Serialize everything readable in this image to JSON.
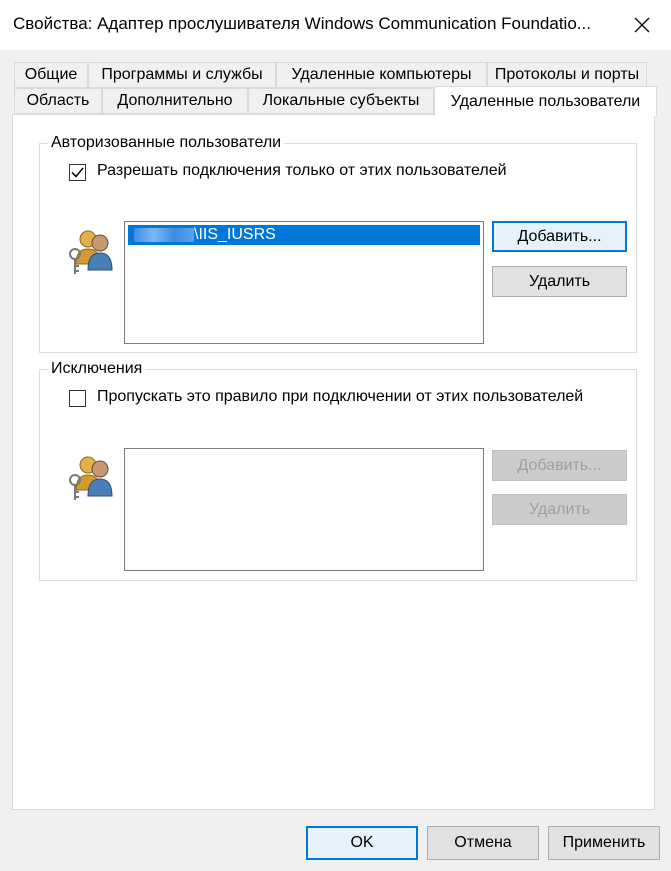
{
  "window": {
    "title": "Свойства: Адаптер прослушивателя Windows Communication Foundatio...",
    "close_icon": "close-icon"
  },
  "tabs_row1": [
    "Общие",
    "Программы и службы",
    "Удаленные компьютеры",
    "Протоколы и порты"
  ],
  "tabs_row2": [
    "Область",
    "Дополнительно",
    "Локальные субъекты",
    "Удаленные пользователи"
  ],
  "active_tab": "Удаленные пользователи",
  "authorized": {
    "legend": "Авторизованные пользователи",
    "checkbox_label": "Разрешать подключения только от этих пользователей",
    "checked": true,
    "list_items": [
      "\\IIS_IUSRS"
    ],
    "add_label": "Добавить...",
    "remove_label": "Удалить",
    "icon": "users-key-icon"
  },
  "exceptions": {
    "legend": "Исключения",
    "checkbox_label": "Пропускать это правило при подключении от этих пользователей",
    "checked": false,
    "list_items": [],
    "add_label": "Добавить...",
    "remove_label": "Удалить",
    "icon": "users-key-icon"
  },
  "footer": {
    "ok_label": "OK",
    "cancel_label": "Отмена",
    "apply_label": "Применить"
  }
}
